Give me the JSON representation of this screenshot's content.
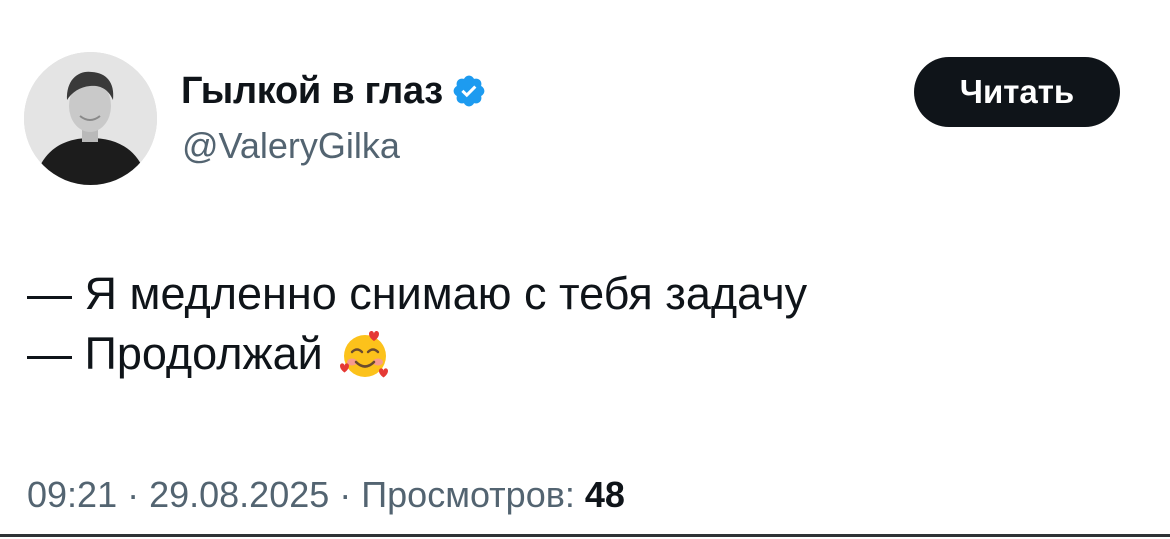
{
  "author": {
    "display_name": "Гылкой в глаз",
    "handle": "@ValeryGilka",
    "verified_icon": "verified-badge-icon",
    "avatar_icon": "avatar"
  },
  "follow_button": {
    "label": "Читать"
  },
  "tweet": {
    "lines": [
      "— Я медленно снимаю с тебя задачу",
      "— Продолжай"
    ],
    "emoji_icon": "smiling-face-with-hearts-icon"
  },
  "meta": {
    "time": "09:21",
    "separator": " · ",
    "date": "29.08.2025",
    "views_label": "Просмотров: ",
    "views_count": "48"
  },
  "colors": {
    "text": "#0f1419",
    "secondary": "#536471",
    "verified": "#1d9bf0",
    "button_bg": "#0f1419",
    "button_text": "#ffffff"
  }
}
